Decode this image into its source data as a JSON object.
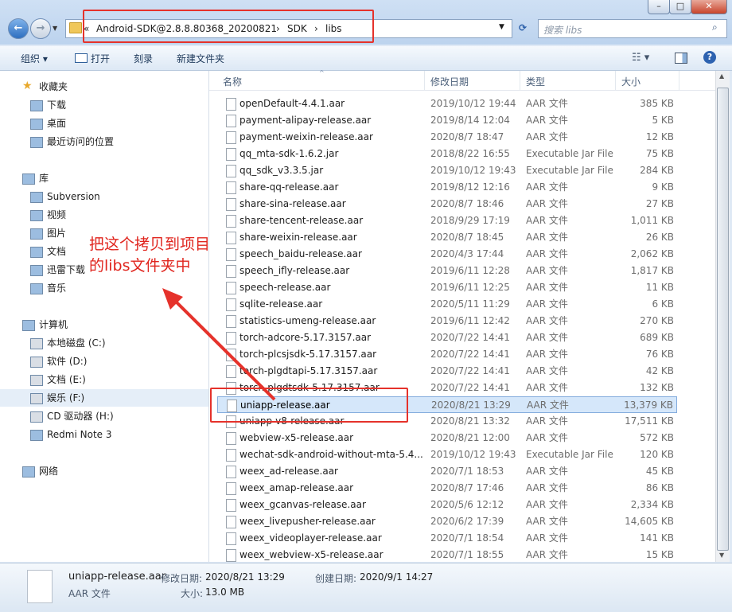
{
  "window": {
    "minimize": "–",
    "maximize": "□",
    "close": "✕",
    "address": {
      "root": "«",
      "segments": [
        "Android-SDK@2.8.8.80368_20200821",
        "SDK",
        "libs"
      ]
    },
    "search_placeholder": "搜索 libs"
  },
  "toolbar": {
    "organize": "组织 ▾",
    "open": "打开",
    "burn": "刻录",
    "new_folder": "新建文件夹"
  },
  "nav": [
    {
      "label": "收藏夹",
      "hdr": true,
      "icon": "star-icon"
    },
    {
      "label": "下载",
      "icon": "download-folder-icon"
    },
    {
      "label": "桌面",
      "icon": "desktop-icon"
    },
    {
      "label": "最近访问的位置",
      "icon": "recent-places-icon"
    },
    {
      "label": "库",
      "hdr": true,
      "icon": "library-icon"
    },
    {
      "label": "Subversion",
      "icon": "folder-icon"
    },
    {
      "label": "视频",
      "icon": "video-icon"
    },
    {
      "label": "图片",
      "icon": "picture-icon"
    },
    {
      "label": "文档",
      "icon": "document-icon"
    },
    {
      "label": "迅雷下载",
      "icon": "folder-icon"
    },
    {
      "label": "音乐",
      "icon": "music-icon"
    },
    {
      "label": "计算机",
      "hdr": true,
      "icon": "computer-icon"
    },
    {
      "label": "本地磁盘 (C:)",
      "icon": "drive-icon"
    },
    {
      "label": "软件 (D:)",
      "icon": "drive-icon"
    },
    {
      "label": "文档 (E:)",
      "icon": "drive-icon"
    },
    {
      "label": "娱乐 (F:)",
      "icon": "drive-icon",
      "selected": true
    },
    {
      "label": "CD 驱动器 (H:)",
      "icon": "cd-drive-icon"
    },
    {
      "label": "Redmi Note 3",
      "icon": "phone-icon"
    },
    {
      "label": "网络",
      "hdr": true,
      "icon": "network-icon"
    }
  ],
  "columns": {
    "name": "名称",
    "date": "修改日期",
    "type": "类型",
    "size": "大小"
  },
  "files": [
    {
      "name": "openDefault-4.4.1.aar",
      "date": "2019/10/12 19:44",
      "type": "AAR 文件",
      "size": "385 KB"
    },
    {
      "name": "payment-alipay-release.aar",
      "date": "2019/8/14 12:04",
      "type": "AAR 文件",
      "size": "5 KB"
    },
    {
      "name": "payment-weixin-release.aar",
      "date": "2020/8/7 18:47",
      "type": "AAR 文件",
      "size": "12 KB"
    },
    {
      "name": "qq_mta-sdk-1.6.2.jar",
      "date": "2018/8/22 16:55",
      "type": "Executable Jar File",
      "size": "75 KB"
    },
    {
      "name": "qq_sdk_v3.3.5.jar",
      "date": "2019/10/12 19:43",
      "type": "Executable Jar File",
      "size": "284 KB"
    },
    {
      "name": "share-qq-release.aar",
      "date": "2019/8/12 12:16",
      "type": "AAR 文件",
      "size": "9 KB"
    },
    {
      "name": "share-sina-release.aar",
      "date": "2020/8/7 18:46",
      "type": "AAR 文件",
      "size": "27 KB"
    },
    {
      "name": "share-tencent-release.aar",
      "date": "2018/9/29 17:19",
      "type": "AAR 文件",
      "size": "1,011 KB"
    },
    {
      "name": "share-weixin-release.aar",
      "date": "2020/8/7 18:45",
      "type": "AAR 文件",
      "size": "26 KB"
    },
    {
      "name": "speech_baidu-release.aar",
      "date": "2020/4/3 17:44",
      "type": "AAR 文件",
      "size": "2,062 KB"
    },
    {
      "name": "speech_ifly-release.aar",
      "date": "2019/6/11 12:28",
      "type": "AAR 文件",
      "size": "1,817 KB"
    },
    {
      "name": "speech-release.aar",
      "date": "2019/6/11 12:25",
      "type": "AAR 文件",
      "size": "11 KB"
    },
    {
      "name": "sqlite-release.aar",
      "date": "2020/5/11 11:29",
      "type": "AAR 文件",
      "size": "6 KB"
    },
    {
      "name": "statistics-umeng-release.aar",
      "date": "2019/6/11 12:42",
      "type": "AAR 文件",
      "size": "270 KB"
    },
    {
      "name": "torch-adcore-5.17.3157.aar",
      "date": "2020/7/22 14:41",
      "type": "AAR 文件",
      "size": "689 KB"
    },
    {
      "name": "torch-plcsjsdk-5.17.3157.aar",
      "date": "2020/7/22 14:41",
      "type": "AAR 文件",
      "size": "76 KB"
    },
    {
      "name": "torch-plgdtapi-5.17.3157.aar",
      "date": "2020/7/22 14:41",
      "type": "AAR 文件",
      "size": "42 KB"
    },
    {
      "name": "torch-plgdtsdk-5.17.3157.aar",
      "date": "2020/7/22 14:41",
      "type": "AAR 文件",
      "size": "132 KB"
    },
    {
      "name": "uniapp-release.aar",
      "date": "2020/8/21 13:29",
      "type": "AAR 文件",
      "size": "13,379 KB",
      "selected": true
    },
    {
      "name": "uniapp-v8-release.aar",
      "date": "2020/8/21 13:32",
      "type": "AAR 文件",
      "size": "17,511 KB"
    },
    {
      "name": "webview-x5-release.aar",
      "date": "2020/8/21 12:00",
      "type": "AAR 文件",
      "size": "572 KB"
    },
    {
      "name": "wechat-sdk-android-without-mta-5.4....",
      "date": "2019/10/12 19:43",
      "type": "Executable Jar File",
      "size": "120 KB"
    },
    {
      "name": "weex_ad-release.aar",
      "date": "2020/7/1 18:53",
      "type": "AAR 文件",
      "size": "45 KB"
    },
    {
      "name": "weex_amap-release.aar",
      "date": "2020/8/7 17:46",
      "type": "AAR 文件",
      "size": "86 KB"
    },
    {
      "name": "weex_gcanvas-release.aar",
      "date": "2020/5/6 12:12",
      "type": "AAR 文件",
      "size": "2,334 KB"
    },
    {
      "name": "weex_livepusher-release.aar",
      "date": "2020/6/2 17:39",
      "type": "AAR 文件",
      "size": "14,605 KB"
    },
    {
      "name": "weex_videoplayer-release.aar",
      "date": "2020/7/1 18:54",
      "type": "AAR 文件",
      "size": "141 KB"
    },
    {
      "name": "weex_webview-x5-release.aar",
      "date": "2020/7/1 18:55",
      "type": "AAR 文件",
      "size": "15 KB"
    }
  ],
  "details": {
    "name": "uniapp-release.aar",
    "type": "AAR 文件",
    "modified_label": "修改日期:",
    "modified": "2020/8/21 13:29",
    "created_label": "创建日期:",
    "created": "2020/9/1 14:27",
    "size_label": "大小:",
    "size": "13.0 MB"
  },
  "annotation": "把这个拷贝到项目\n的libs文件夹中",
  "colors": {
    "annotation": "#e5322b",
    "selection": "#d5e7fa"
  }
}
